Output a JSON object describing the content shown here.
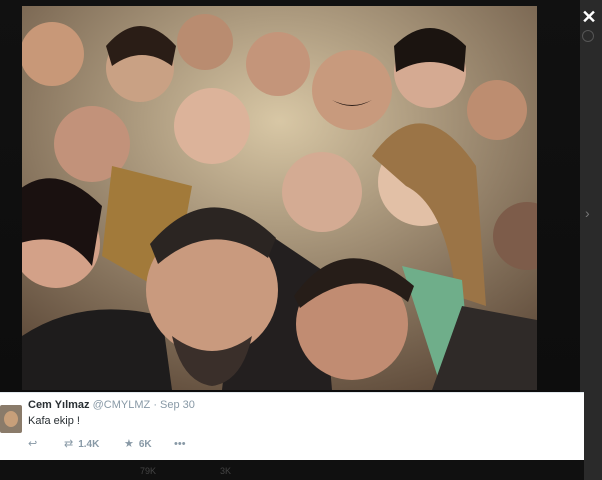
{
  "viewer": {
    "close_icon": "close-icon",
    "next_icon": "chevron-right-icon",
    "photo_alt": "Group selfie photo"
  },
  "tweet": {
    "author_name": "Cem Yılmaz",
    "author_handle": "@CMYLMZ",
    "separator": "·",
    "date": "Sep 30",
    "text": "Kafa ekip !",
    "actions": {
      "reply_icon": "reply-icon",
      "retweet_icon": "retweet-icon",
      "retweet_count": "1.4K",
      "favorite_icon": "star-icon",
      "favorite_count": "6K",
      "more_icon": "more-icon"
    }
  },
  "background_row": {
    "count_a": "79K",
    "count_b": "3K"
  },
  "colors": {
    "overlay": "#0a0a0a",
    "card": "#ffffff",
    "muted_text": "#8899a6",
    "body_text": "#292f33"
  }
}
